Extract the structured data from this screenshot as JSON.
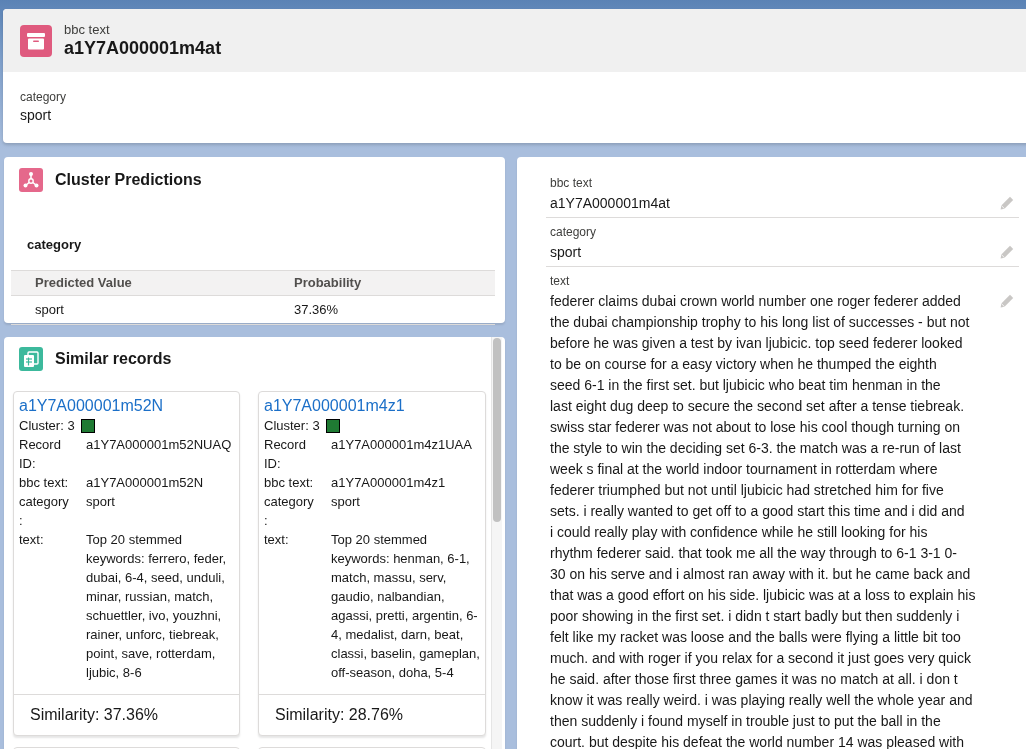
{
  "header": {
    "object_label": "bbc text",
    "title": "a1Y7A000001m4at",
    "fields": [
      {
        "label": "category",
        "value": "sport"
      }
    ]
  },
  "cluster_predictions": {
    "title": "Cluster Predictions",
    "field": "category",
    "columns": [
      "Predicted Value",
      "Probability"
    ],
    "rows": [
      [
        "sport",
        "37.36%"
      ]
    ]
  },
  "similar_records": {
    "title": "Similar records",
    "cards": [
      {
        "link": "a1Y7A000001m52N",
        "cluster": "Cluster: 3",
        "color": "#1f7a33",
        "fields": [
          {
            "label": "Record ID:",
            "value": "a1Y7A000001m52NUAQ"
          },
          {
            "label": "bbc text:",
            "value": "a1Y7A000001m52N"
          },
          {
            "label": "category:",
            "value": "sport"
          },
          {
            "label": "text:",
            "value_lines": [
              "Top 20 stemmed",
              "keywords: ferrero, feder,",
              "dubai, 6-4, seed, unduli,",
              "minar, russian, match,",
              "schuettler, ivo, youzhni,",
              "rainer, unforc, tiebreak,",
              "point, save, rotterdam,",
              "ljubic, 8-6"
            ]
          }
        ],
        "similarity": "Similarity: 37.36%"
      },
      {
        "link": "a1Y7A000001m4z1",
        "cluster": "Cluster: 3",
        "color": "#1f7a33",
        "fields": [
          {
            "label": "Record ID:",
            "value": "a1Y7A000001m4z1UAA"
          },
          {
            "label": "bbc text:",
            "value": "a1Y7A000001m4z1"
          },
          {
            "label": "category:",
            "value": "sport"
          },
          {
            "label": "text:",
            "value_lines": [
              "Top 20 stemmed",
              "keywords: henman, 6-1,",
              "match, massu, serv,",
              "gaudio, nalbandian,",
              "agassi, pretti, argentin, 6-",
              "4, medalist, darn, beat,",
              "classi, baselin, gameplan,",
              "off-season, doha, 5-4"
            ]
          }
        ],
        "similarity": "Similarity: 28.76%"
      }
    ]
  },
  "detail": {
    "fields": [
      {
        "label": "bbc text",
        "value": "a1Y7A000001m4at"
      },
      {
        "label": "category",
        "value": "sport"
      },
      {
        "label": "text",
        "value_lines": [
          "federer claims dubai crown world number one roger federer added",
          "the dubai championship trophy to his long list of successes - but not",
          "before he was given a test by ivan ljubicic. top seed federer looked",
          "to be on course for a easy victory when he thumped the eighth",
          "seed 6-1 in the first set. but ljubicic who beat tim henman in the",
          "last eight dug deep to secure the second set after a tense tiebreak.",
          "swiss star federer was not about to lose his cool though turning on",
          "the style to win the deciding set 6-3. the match was a re-run of last",
          "week s final at the world indoor tournament in rotterdam where",
          "federer triumphed but not until ljubicic had stretched him for five",
          "sets. i really wanted to get off to a good start this time and i did and",
          "i could really play with confidence while he still looking for his",
          "rhythm federer said. that took me all the way through to 6-1 3-1 0-",
          "30 on his serve and i almost ran away with it. but he came back and",
          "that was a good effort on his side. ljubicic was at a loss to explain his",
          "poor showing in the first set. i didn t start badly but then suddenly i",
          "felt like my racket was loose and the balls were flying a little bit too",
          "much. and with roger if you relax for a second it just goes very quick",
          "he said. after those first three games it was no match at all. i don t",
          "know it was really weird. i was playing really well the whole year and",
          "then suddenly i found myself in trouble just to put the ball in the",
          "court. but despite his defeat the world number 14 was pleased with"
        ]
      }
    ]
  }
}
